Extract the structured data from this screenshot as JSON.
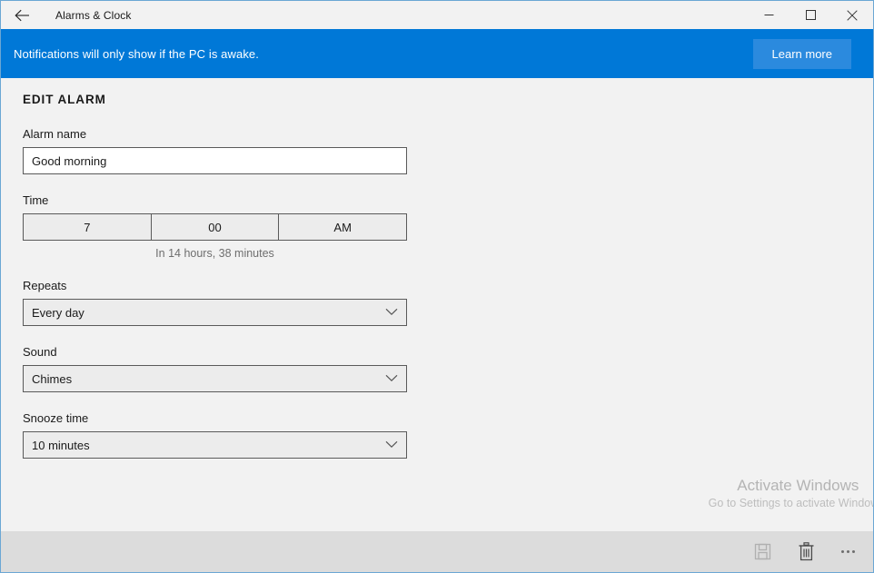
{
  "window": {
    "app_title": "Alarms & Clock",
    "back_icon": "back-arrow-icon",
    "minimize_icon": "minimize-icon",
    "maximize_icon": "maximize-icon",
    "close_icon": "close-icon"
  },
  "banner": {
    "message": "Notifications will only show if the PC is awake.",
    "action_label": "Learn more",
    "background_color": "#0078d7",
    "button_color": "#2b8ade"
  },
  "page": {
    "title": "EDIT ALARM"
  },
  "fields": {
    "alarm_name": {
      "label": "Alarm name",
      "value": "Good morning",
      "placeholder": "Alarm name"
    },
    "time": {
      "label": "Time",
      "hour": "7",
      "minute": "00",
      "period": "AM",
      "hint": "In 14 hours, 38 minutes"
    },
    "repeats": {
      "label": "Repeats",
      "value": "Every day"
    },
    "sound": {
      "label": "Sound",
      "value": "Chimes"
    },
    "snooze": {
      "label": "Snooze time",
      "value": "10 minutes"
    }
  },
  "commandbar": {
    "save_icon": "save-floppy-icon",
    "delete_icon": "trash-icon",
    "more_icon": "ellipsis-icon"
  },
  "watermark": {
    "line1": "Activate Windows",
    "line2": "Go to Settings to activate Windows."
  }
}
